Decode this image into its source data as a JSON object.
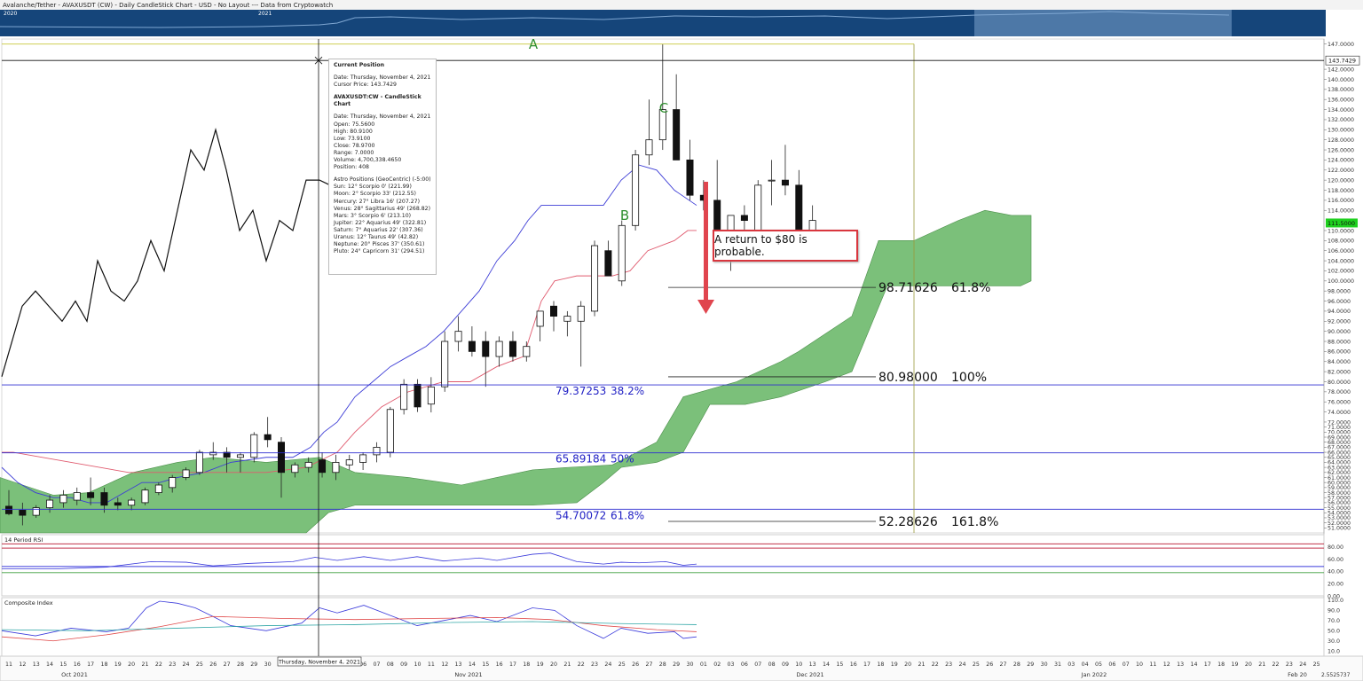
{
  "header": {
    "title": "Avalanche/Tether - AVAXUSDT (CW) - Daily CandleStick Chart - USD - No Layout --- Data from Cryptowatch",
    "nav_year_1": "2020",
    "nav_year_2": "2021"
  },
  "tooltip": {
    "title": "Current Position",
    "date": "Date: Thursday, November 4, 2021",
    "cursor_price": "Cursor Price: 143.7429",
    "series_title": "AVAXUSDT:CW - CandleStick Chart",
    "lines": [
      "Date: Thursday, November 4, 2021",
      "Open: 75.5600",
      "High: 80.9100",
      "Low: 73.9100",
      "Close: 78.9700",
      "Range: 7.0000",
      "Volume: 4,700,338.4650",
      "Position: 408"
    ],
    "astro_title": "Astro Positions (GeoCentric) (-5:00)",
    "astro": [
      "Sun: 12° Scorpio 0' (221.99)",
      "Moon: 2° Scorpio 33' (212.55)",
      "Mercury: 27° Libra 16' (207.27)",
      "Venus: 28° Sagittarius 49' (268.82)",
      "Mars: 3° Scorpio 6' (213.10)",
      "Jupiter: 22° Aquarius 49' (322.81)",
      "Saturn: 7° Aquarius 22' (307.36)",
      "Uranus: 12° Taurus 49' (42.82)",
      "Neptune: 20° Pisces 37' (350.61)",
      "Pluto: 24° Capricorn 31' (294.51)"
    ]
  },
  "callout": "A return to $80 is probable.",
  "chart_data": [
    {
      "type": "candlestick",
      "ylim": [
        50,
        148
      ],
      "price_ticks": [
        147,
        142,
        140,
        138,
        136,
        134,
        132,
        130,
        128,
        126,
        124,
        122,
        120,
        118,
        116,
        114,
        110,
        108,
        106,
        104,
        102,
        100,
        98,
        96,
        94,
        92,
        90,
        88,
        86,
        84,
        82,
        80,
        78,
        76,
        74,
        72,
        71,
        70,
        69,
        68,
        67,
        66,
        65,
        64,
        63,
        62,
        61,
        60,
        59,
        58,
        57,
        56,
        55,
        54,
        53,
        52,
        51
      ],
      "crosshair_price": "143.7429",
      "last_price": "111.5000",
      "candles": [
        {
          "o": 55.3,
          "h": 58.5,
          "l": 53.5,
          "c": 53.8
        },
        {
          "o": 54.5,
          "h": 56,
          "l": 51.5,
          "c": 53.5
        },
        {
          "o": 53.5,
          "h": 55.5,
          "l": 53,
          "c": 55
        },
        {
          "o": 55,
          "h": 57.5,
          "l": 54,
          "c": 56.5
        },
        {
          "o": 56,
          "h": 58.5,
          "l": 55,
          "c": 57.5
        },
        {
          "o": 56.5,
          "h": 59,
          "l": 55.5,
          "c": 58
        },
        {
          "o": 58,
          "h": 61,
          "l": 55.5,
          "c": 57
        },
        {
          "o": 58,
          "h": 59,
          "l": 54,
          "c": 55.5
        },
        {
          "o": 56,
          "h": 57,
          "l": 54.5,
          "c": 55.5
        },
        {
          "o": 55.5,
          "h": 57,
          "l": 54.5,
          "c": 56.5
        },
        {
          "o": 56,
          "h": 59,
          "l": 55.5,
          "c": 58.5
        },
        {
          "o": 58,
          "h": 60,
          "l": 57.5,
          "c": 59.5
        },
        {
          "o": 59,
          "h": 61.5,
          "l": 58,
          "c": 61
        },
        {
          "o": 61,
          "h": 63,
          "l": 60.5,
          "c": 62.5
        },
        {
          "o": 62,
          "h": 66.5,
          "l": 61.5,
          "c": 66
        },
        {
          "o": 65.5,
          "h": 68,
          "l": 64.5,
          "c": 66
        },
        {
          "o": 66,
          "h": 67,
          "l": 62,
          "c": 65
        },
        {
          "o": 65,
          "h": 66,
          "l": 62,
          "c": 65.5
        },
        {
          "o": 65,
          "h": 70,
          "l": 64,
          "c": 69.5
        },
        {
          "o": 69.5,
          "h": 73,
          "l": 67,
          "c": 68.5
        },
        {
          "o": 68,
          "h": 69,
          "l": 57,
          "c": 62
        },
        {
          "o": 62,
          "h": 64,
          "l": 61,
          "c": 63.5
        },
        {
          "o": 63,
          "h": 65,
          "l": 62,
          "c": 64
        },
        {
          "o": 64.5,
          "h": 66,
          "l": 61,
          "c": 62
        },
        {
          "o": 62,
          "h": 65.5,
          "l": 60.5,
          "c": 64
        },
        {
          "o": 63.5,
          "h": 65.5,
          "l": 62.5,
          "c": 64.5
        },
        {
          "o": 64,
          "h": 66,
          "l": 62.5,
          "c": 65.5
        },
        {
          "o": 65.5,
          "h": 68,
          "l": 64,
          "c": 67
        },
        {
          "o": 66,
          "h": 75,
          "l": 65,
          "c": 74.5
        },
        {
          "o": 74.5,
          "h": 80.5,
          "l": 73.5,
          "c": 79.5
        },
        {
          "o": 79.5,
          "h": 80.5,
          "l": 74,
          "c": 75
        },
        {
          "o": 75.56,
          "h": 80.91,
          "l": 73.91,
          "c": 78.97
        },
        {
          "o": 79,
          "h": 90,
          "l": 78,
          "c": 88
        },
        {
          "o": 88,
          "h": 93,
          "l": 86,
          "c": 90
        },
        {
          "o": 88,
          "h": 91,
          "l": 85,
          "c": 86
        },
        {
          "o": 88,
          "h": 90,
          "l": 79,
          "c": 85
        },
        {
          "o": 85,
          "h": 89,
          "l": 83,
          "c": 88
        },
        {
          "o": 88,
          "h": 90,
          "l": 84,
          "c": 85
        },
        {
          "o": 85,
          "h": 88,
          "l": 84,
          "c": 87
        },
        {
          "o": 91,
          "h": 94,
          "l": 88,
          "c": 94
        },
        {
          "o": 95,
          "h": 96,
          "l": 90,
          "c": 93
        },
        {
          "o": 92,
          "h": 94,
          "l": 89,
          "c": 93
        },
        {
          "o": 92,
          "h": 96,
          "l": 83,
          "c": 95
        },
        {
          "o": 94,
          "h": 108,
          "l": 93,
          "c": 107
        },
        {
          "o": 106,
          "h": 108,
          "l": 101,
          "c": 101
        },
        {
          "o": 100,
          "h": 112,
          "l": 99,
          "c": 111
        },
        {
          "o": 111,
          "h": 126,
          "l": 110,
          "c": 125
        },
        {
          "o": 125,
          "h": 136,
          "l": 123,
          "c": 128
        },
        {
          "o": 128,
          "h": 147,
          "l": 126,
          "c": 134
        },
        {
          "o": 134,
          "h": 141,
          "l": 124,
          "c": 124
        },
        {
          "o": 124,
          "h": 128,
          "l": 116,
          "c": 117
        },
        {
          "o": 117,
          "h": 120,
          "l": 114,
          "c": 116
        },
        {
          "o": 116,
          "h": 124,
          "l": 104,
          "c": 106
        },
        {
          "o": 106,
          "h": 110,
          "l": 102,
          "c": 113
        },
        {
          "o": 113,
          "h": 115,
          "l": 104,
          "c": 112
        },
        {
          "o": 110,
          "h": 120,
          "l": 107,
          "c": 119
        },
        {
          "o": 120,
          "h": 124,
          "l": 115,
          "c": 120
        },
        {
          "o": 120,
          "h": 127,
          "l": 117,
          "c": 119
        },
        {
          "o": 119,
          "h": 122,
          "l": 108,
          "c": 109
        },
        {
          "o": 109,
          "h": 115,
          "l": 107,
          "c": 112
        }
      ],
      "fib_levels": [
        {
          "value": "79.37253",
          "pct": "38.2%"
        },
        {
          "value": "65.89184",
          "pct": "50%"
        },
        {
          "value": "54.70072",
          "pct": "61.8%"
        }
      ],
      "ext_levels": [
        {
          "value": "98.71626",
          "pct": "61.8%"
        },
        {
          "value": "80.98000",
          "pct": "100%"
        },
        {
          "value": "52.28626",
          "pct": "161.8%"
        }
      ],
      "wave_labels": [
        "A",
        "B",
        "C"
      ]
    },
    {
      "type": "line",
      "title": "14 Period RSI",
      "ylim": [
        0,
        100
      ],
      "ticks": [
        "80.00",
        "60.00",
        "40.00",
        "20.00",
        "0.00"
      ]
    },
    {
      "type": "line",
      "title": "Composite Index",
      "ylim": [
        0,
        115
      ],
      "ticks": [
        "110.0",
        "90.0",
        "70.0",
        "50.0",
        "30.0",
        "10.0"
      ]
    }
  ],
  "x_axis": {
    "days": [
      "11",
      "12",
      "13",
      "14",
      "15",
      "16",
      "17",
      "18",
      "19",
      "20",
      "21",
      "22",
      "23",
      "24",
      "25",
      "26",
      "27",
      "28",
      "29",
      "30",
      "31",
      "01",
      "02",
      "03",
      "04",
      "05",
      "06",
      "07",
      "08",
      "09",
      "10",
      "11",
      "12",
      "13",
      "14",
      "15",
      "16",
      "17",
      "18",
      "19",
      "20",
      "21",
      "22",
      "23",
      "24",
      "25",
      "26",
      "27",
      "28",
      "29",
      "30",
      "01",
      "02",
      "03",
      "06",
      "07",
      "08",
      "09",
      "10",
      "13",
      "14",
      "15",
      "16",
      "17",
      "18",
      "19",
      "20",
      "21",
      "22",
      "23",
      "24",
      "25",
      "26",
      "27",
      "28",
      "29",
      "30",
      "31",
      "03",
      "04",
      "05",
      "06",
      "07",
      "10",
      "11",
      "12",
      "13",
      "14",
      "17",
      "18",
      "19",
      "20",
      "21",
      "22",
      "23",
      "24",
      "25",
      "26",
      "27",
      "28",
      "29",
      "30",
      "31",
      "01",
      "02",
      "03",
      "04",
      "07",
      "08",
      "09"
    ],
    "months": [
      "Oct 2021",
      "Nov 2021",
      "Dec 2021",
      "Jan 2022",
      "Feb 20"
    ],
    "crosshair_date": "Thursday, November 4, 2021",
    "corner_value": "2.5525737"
  }
}
